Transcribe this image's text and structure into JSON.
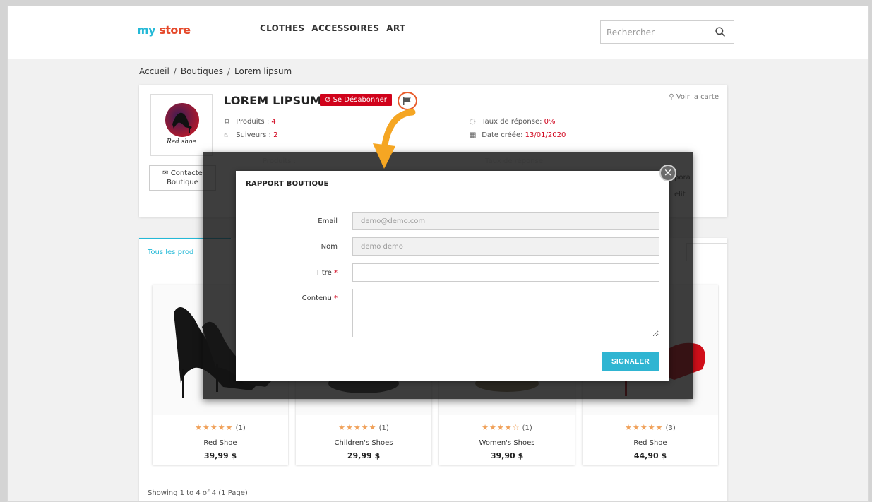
{
  "header": {
    "logo_part1": "my",
    "logo_part2": "store",
    "nav": [
      "CLOTHES",
      "ACCESSOIRES",
      "ART"
    ],
    "search_placeholder": "Rechercher"
  },
  "breadcrumb": [
    "Accueil",
    "Boutiques",
    "Lorem lipsum"
  ],
  "shop": {
    "logo_text": "Red shoe",
    "title": "LOREM LIPSUM",
    "unsubscribe_label": "Se Désabonner",
    "map_link": "Voir la carte",
    "contact_label_line1": "Contacte",
    "contact_label_line2": "Boutique",
    "stats": {
      "products_label": "Produits :",
      "products_value": "4",
      "followers_label": "Suiveurs :",
      "followers_value": "2",
      "response_label": "Taux de réponse:",
      "response_value": "0%",
      "created_label": "Date créée:",
      "created_value": "13/01/2020"
    },
    "partial_texts": [
      "pora",
      "elit"
    ]
  },
  "products_tab": "Tous les prod",
  "products": [
    {
      "stars": "★★★★★",
      "count": "(1)",
      "name": "Red Shoe",
      "price": "39,99 $"
    },
    {
      "stars": "★★★★★",
      "count": "(1)",
      "name": "Children's Shoes",
      "price": "29,99 $"
    },
    {
      "stars": "★★★★☆",
      "count": "(1)",
      "name": "Women's Shoes",
      "price": "39,90 $"
    },
    {
      "stars": "★★★★★",
      "count": "(3)",
      "name": "Red Shoe",
      "price": "44,90 $"
    }
  ],
  "showing": "Showing 1 to 4 of 4 (1 Page)",
  "modal": {
    "title": "RAPPORT BOUTIQUE",
    "email_label": "Email",
    "email_value": "demo@demo.com",
    "name_label": "Nom",
    "name_value": "demo demo",
    "title_label": "Titre",
    "content_label": "Contenu",
    "required_mark": "*",
    "submit_label": "SIGNALER",
    "close_glyph": "×"
  },
  "colors": {
    "accent": "#2fb5d2",
    "danger": "#d0021b",
    "star": "#f0a15a",
    "arrow": "#f5a623"
  }
}
